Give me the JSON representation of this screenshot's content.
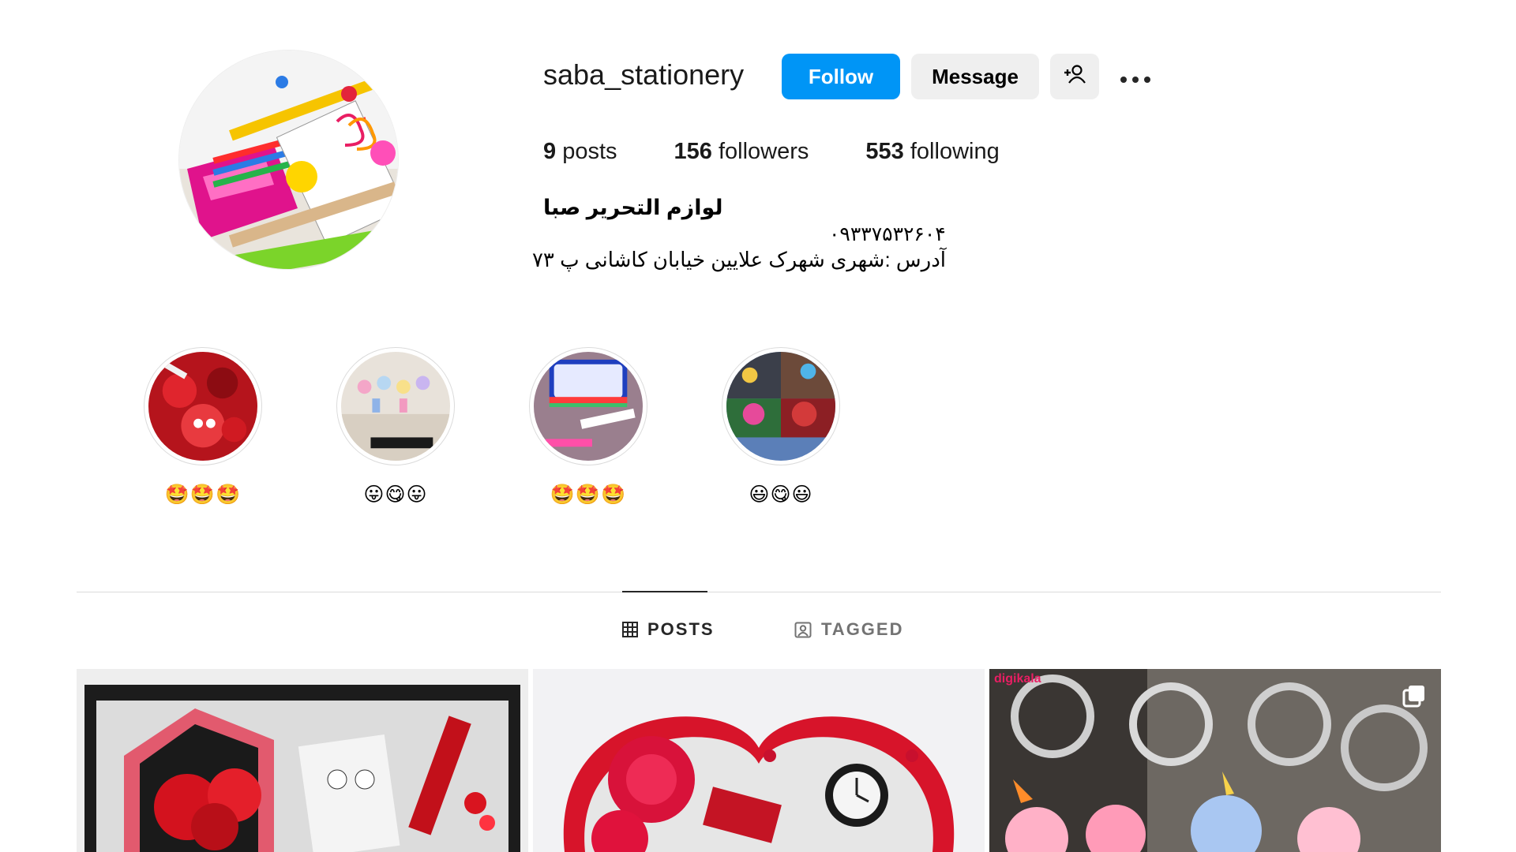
{
  "profile": {
    "username": "saba_stationery",
    "follow_label": "Follow",
    "message_label": "Message",
    "suggest_icon": "person-add-icon",
    "more_icon": "more-options-icon",
    "stats": {
      "posts_count": "9",
      "posts_label": "posts",
      "followers_count": "156",
      "followers_label": "followers",
      "following_count": "553",
      "following_label": "following"
    },
    "full_name": "لوازم التحریر صبا",
    "bio_phone": "۰۹۳۳۷۵۳۲۶۰۴",
    "bio_address": "آدرس :شهری شهرک علایین خیابان کاشانی پ ۷۳"
  },
  "highlights": [
    {
      "label": "🤩🤩🤩"
    },
    {
      "label": "😛😋😛"
    },
    {
      "label": "🤩🤩🤩"
    },
    {
      "label": "😃😋😃"
    }
  ],
  "tabs": {
    "posts_label": "POSTS",
    "tagged_label": "TAGGED"
  },
  "posts": {
    "third_watermark": "digikala",
    "third_badge_icon": "multiple-posts-icon"
  },
  "colors": {
    "accent": "#0095f6",
    "secondary_button": "#efefef",
    "divider": "#dbdbdb",
    "muted_text": "#737373"
  }
}
